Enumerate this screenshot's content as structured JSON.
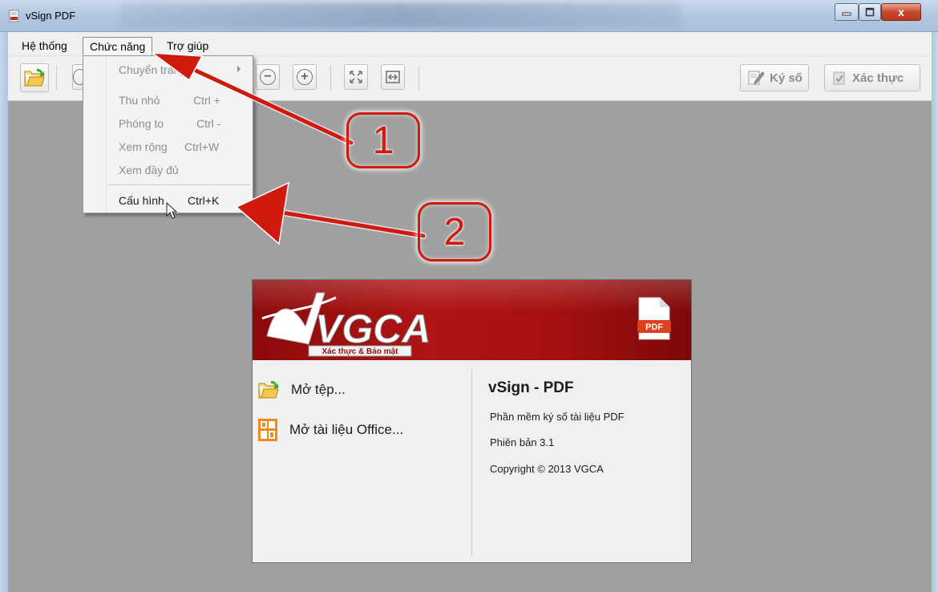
{
  "window": {
    "title": "vSign PDF",
    "close_glyph": "x"
  },
  "menubar": {
    "items": [
      "Hệ thống",
      "Chức năng",
      "Trợ giúp"
    ]
  },
  "dropdown": {
    "items": [
      {
        "label": "Chuyển trang",
        "shortcut": "",
        "has_submenu": true,
        "enabled": false
      },
      {
        "label": "Thu nhỏ",
        "shortcut": "Ctrl +",
        "enabled": false
      },
      {
        "label": "Phóng to",
        "shortcut": "Ctrl -",
        "enabled": false
      },
      {
        "label": "Xem rộng",
        "shortcut": "Ctrl+W",
        "enabled": false
      },
      {
        "label": "Xem đầy đủ",
        "shortcut": "",
        "enabled": false
      },
      {
        "label": "Cấu hình",
        "shortcut": "Ctrl+K",
        "enabled": true
      }
    ]
  },
  "toolbar": {
    "zoom_out_glyph": "−",
    "zoom_in_glyph": "+",
    "sign_label": "Ký số",
    "verify_label": "Xác thực"
  },
  "welcome": {
    "logo_text": "VGCA",
    "logo_tagline": "Xác thực & Bảo mật",
    "pdf_badge": "PDF",
    "open_file": "Mở tệp...",
    "open_office": "Mở tài liệu Office...",
    "app_name": "vSign - PDF",
    "description": "Phần mềm ký số tài liệu PDF",
    "version": "Phiên bản 3.1",
    "copyright": "Copyright © 2013 VGCA"
  },
  "annotations": {
    "callout_1": "1",
    "callout_2": "2"
  },
  "colors": {
    "annotation_red": "#d01a0e",
    "banner_red": "#a51010",
    "workspace_grey": "#a0a0a0"
  }
}
